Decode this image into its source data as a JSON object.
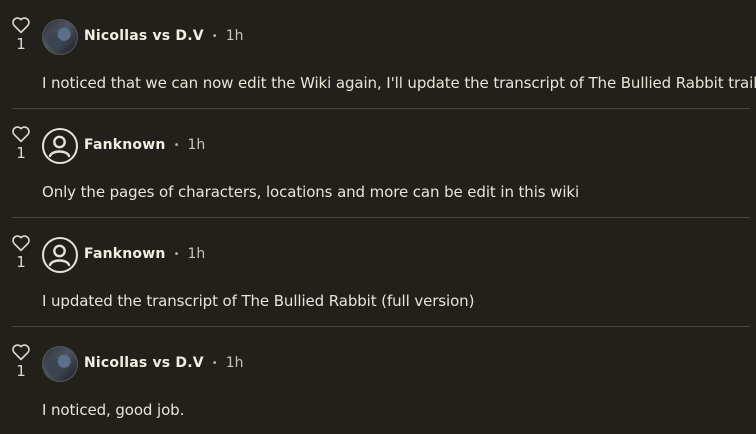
{
  "replies": [
    {
      "likes": "1",
      "avatar": "user-photo",
      "author": "Nicollas vs D.V",
      "separator": "•",
      "time": "1h",
      "text": "I noticed that we can now edit the Wiki again, I'll update the transcript of The Bullied Rabbit trailer."
    },
    {
      "likes": "1",
      "avatar": "default-user-icon",
      "author": "Fanknown",
      "separator": "•",
      "time": "1h",
      "text": "Only the pages of characters, locations and more can be edit in this wiki"
    },
    {
      "likes": "1",
      "avatar": "default-user-icon",
      "author": "Fanknown",
      "separator": "•",
      "time": "1h",
      "text": "I updated the transcript of The Bullied Rabbit (full version)"
    },
    {
      "likes": "1",
      "avatar": "user-photo",
      "author": "Nicollas vs D.V",
      "separator": "•",
      "time": "1h",
      "text": "I noticed, good job."
    }
  ],
  "colors": {
    "background": "#22201a",
    "text": "#e8e4d8",
    "divider": "#4a4740"
  }
}
